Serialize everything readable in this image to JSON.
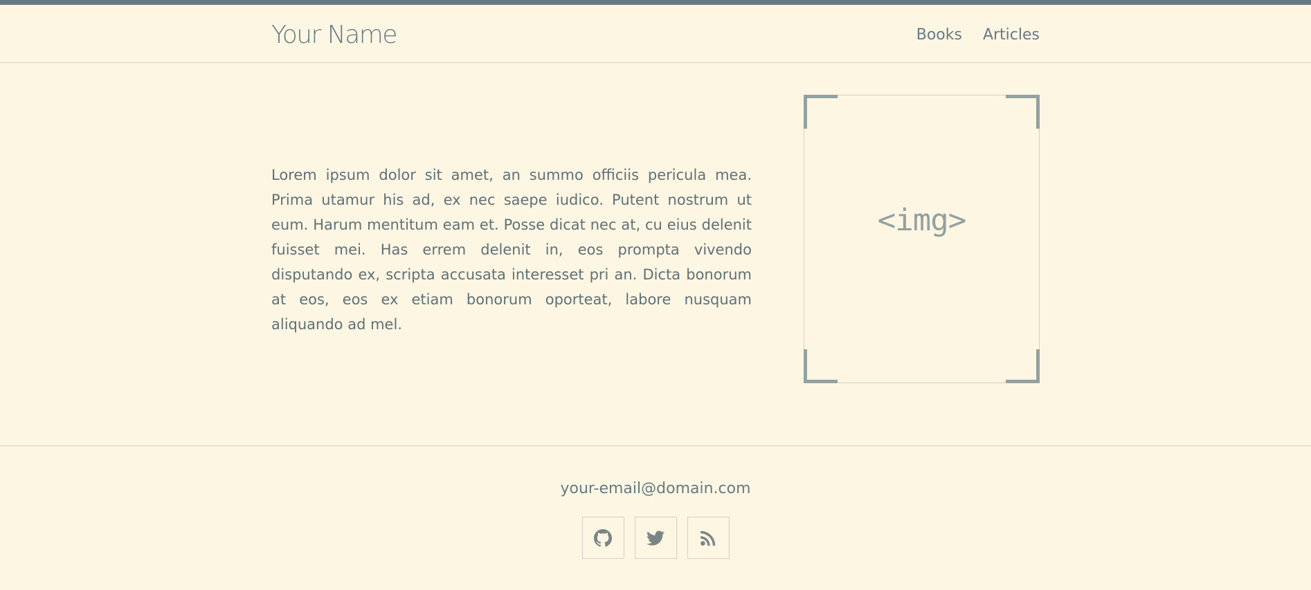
{
  "header": {
    "brand": "Your Name",
    "nav": [
      {
        "label": "Books"
      },
      {
        "label": "Articles"
      }
    ]
  },
  "main": {
    "paragraph": "Lorem ipsum dolor sit amet, an summo officiis pericula mea. Prima utamur his ad, ex nec saepe iudico. Putent nostrum ut eum. Harum mentitum eam et. Posse dicat nec at, cu eius delenit fuisset mei. Has errem delenit in, eos prompta vivendo disputando ex, scripta accusata interesset pri an. Dicta bonorum at eos, eos ex etiam bonorum oporteat, labore nusquam aliquando ad mel.",
    "image_placeholder": "<img>"
  },
  "footer": {
    "email": "your-email@domain.com",
    "socials": [
      {
        "icon": "github-icon"
      },
      {
        "icon": "twitter-icon"
      },
      {
        "icon": "rss-icon"
      }
    ]
  },
  "colors": {
    "background": "#fdf6e3",
    "text": "#586e75",
    "accent": "#657b83",
    "muted": "#93a1a1",
    "border": "#d3cfc2"
  }
}
